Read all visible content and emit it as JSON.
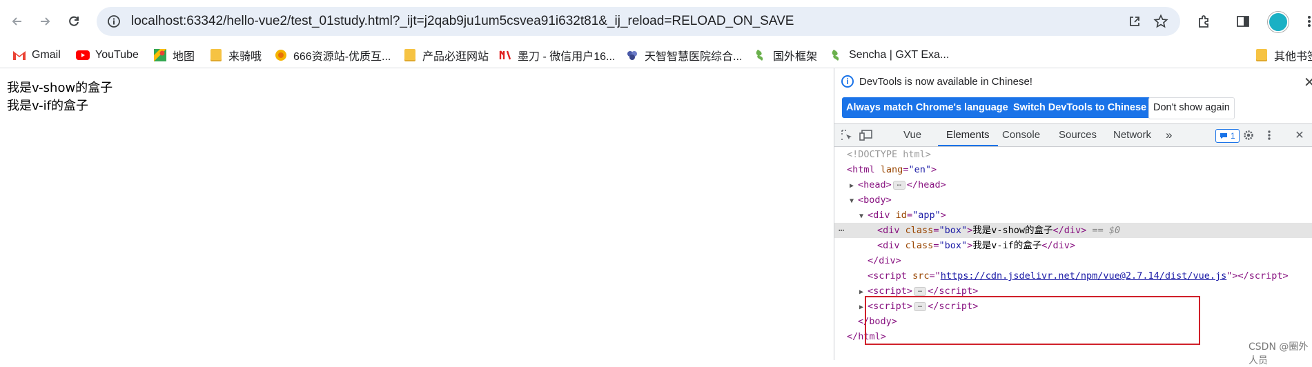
{
  "browser": {
    "url": "localhost:63342/hello-vue2/test_01study.html?_ijt=j2qab9ju1um5csvea91i632t81&_ij_reload=RELOAD_ON_SAVE",
    "bookmarks": [
      {
        "label": "Gmail",
        "icon": "gmail-icon"
      },
      {
        "label": "YouTube",
        "icon": "youtube-icon"
      },
      {
        "label": "地图",
        "icon": "maps-icon"
      },
      {
        "label": "来骑哦",
        "icon": "folder-icon"
      },
      {
        "label": "666资源站-优质互...",
        "icon": "site-icon"
      },
      {
        "label": "产品必逛网站",
        "icon": "folder-icon"
      },
      {
        "label": "墨刀 - 微信用户16...",
        "icon": "modao-icon"
      },
      {
        "label": "天智智慧医院综合...",
        "icon": "site-icon"
      },
      {
        "label": "国外框架",
        "icon": "sencha-icon"
      },
      {
        "label": "Sencha | GXT Exa...",
        "icon": "sencha-icon"
      },
      {
        "label": "其他书签",
        "icon": "folder-icon"
      }
    ]
  },
  "page": {
    "lines": [
      "我是v-show的盒子",
      "我是v-if的盒子"
    ]
  },
  "devtools": {
    "info": "DevTools is now available in Chinese!",
    "buttons": {
      "match": "Always match Chrome's language",
      "switch": "Switch DevTools to Chinese",
      "dont": "Don't show again"
    },
    "tabs": [
      "Vue",
      "Elements",
      "Console",
      "Sources",
      "Network"
    ],
    "active_tab": "Elements",
    "issues_count": "1",
    "tree": {
      "doctype": "<!DOCTYPE html>",
      "html_open": "<html ",
      "lang_attr": "lang",
      "lang_val": "\"en\"",
      "head": "head",
      "body": "body",
      "div": "div",
      "id_attr": "id",
      "id_val": "\"app\"",
      "class_attr": "class",
      "class_val": "\"box\"",
      "text1": "我是v-show的盒子",
      "text2": "我是v-if的盒子",
      "selected_marker": "== $0",
      "script": "script",
      "src_attr": "src",
      "src_val": "https://cdn.jsdelivr.net/npm/vue@2.7.14/dist/vue.js",
      "html": "html"
    },
    "watermark": "CSDN @圈外人员"
  },
  "colors": {
    "accent": "#1a73e8",
    "highlight_box": "#d0202a"
  }
}
